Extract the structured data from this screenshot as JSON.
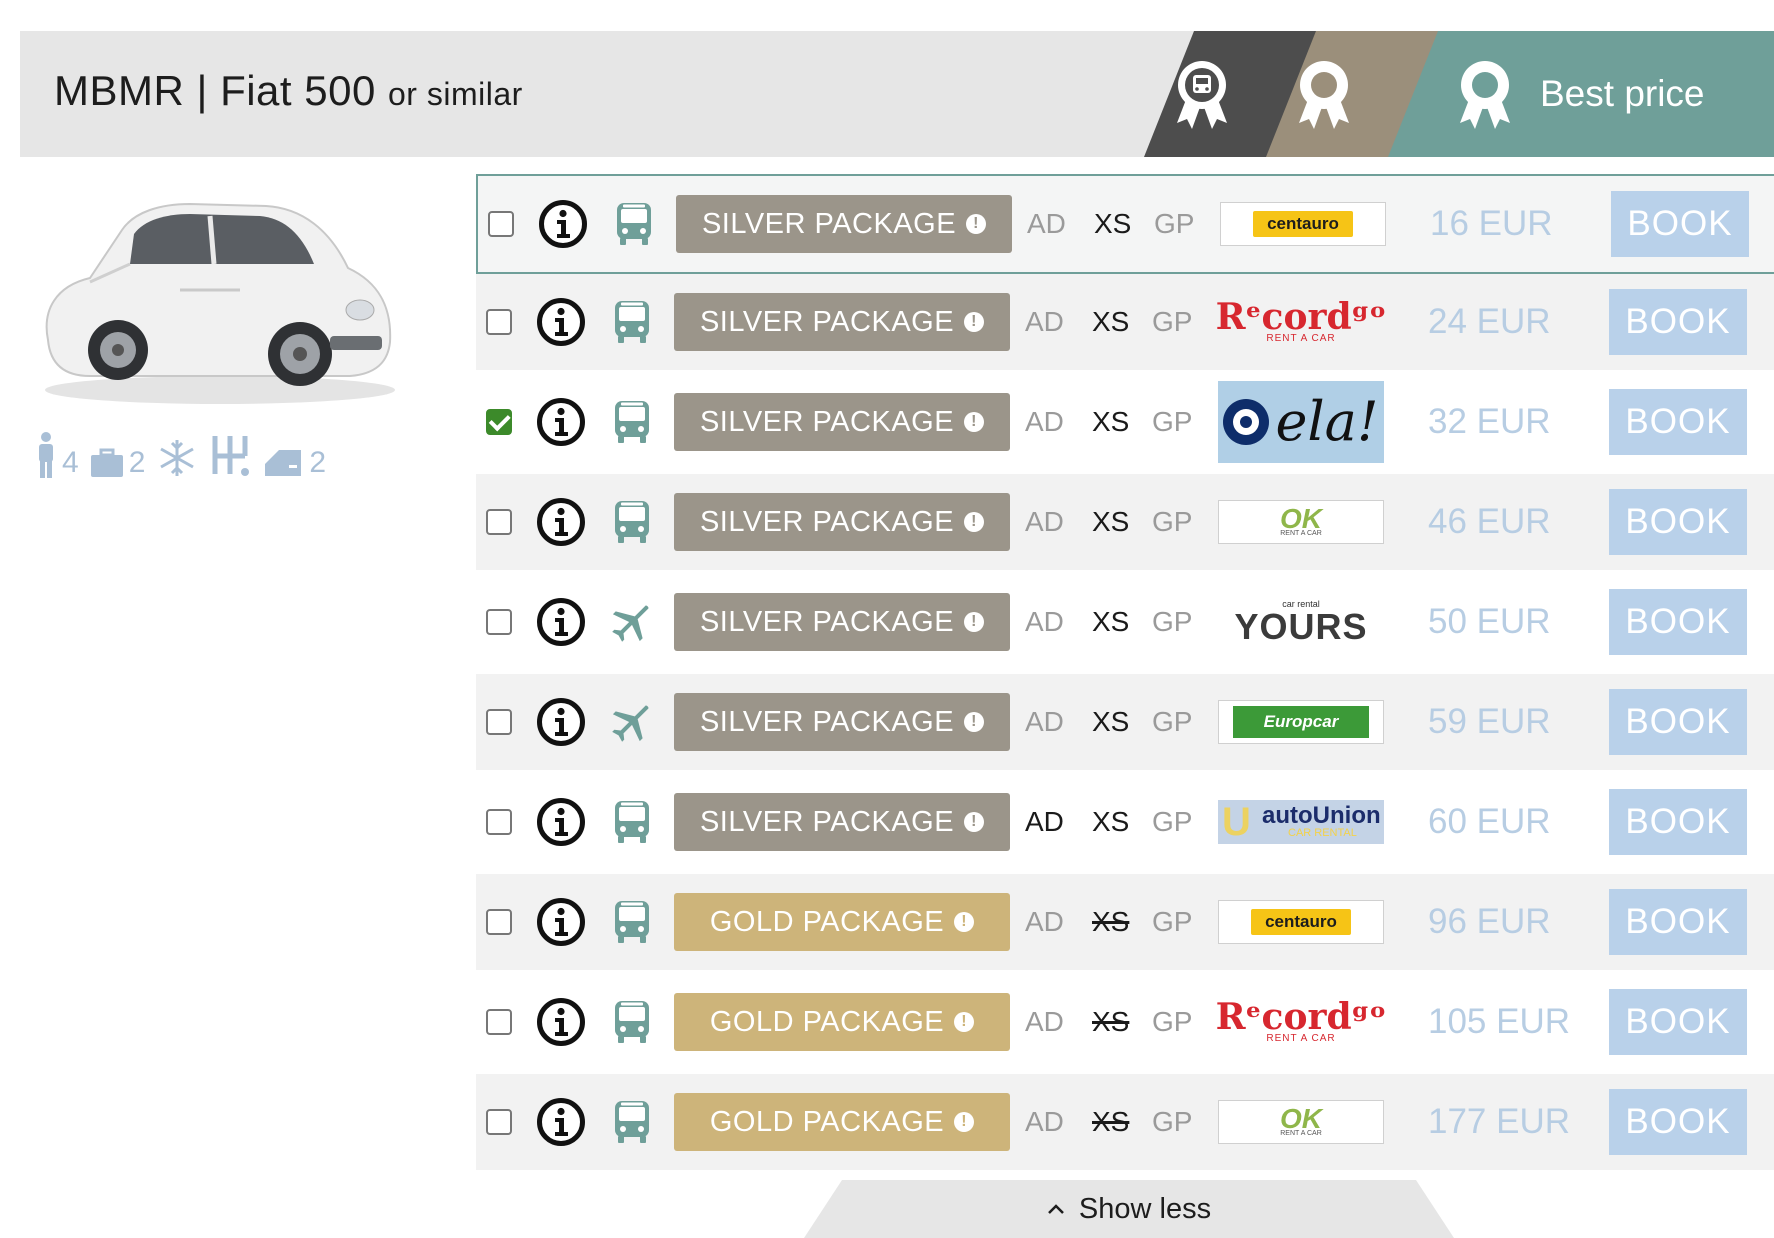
{
  "header": {
    "car_code": "MBMR | Fiat 500",
    "similar": "or similar",
    "best_price_label": "Best price"
  },
  "car": {
    "image_alt": "Fiat 500",
    "specs": {
      "passengers": "4",
      "luggage": "2",
      "doors": "2"
    }
  },
  "offers": [
    {
      "checked": false,
      "transport": "bus",
      "package": "SILVER PACKAGE",
      "tier": "silver",
      "ad": "AD",
      "xs": "XS",
      "gp": "GP",
      "ad_dark": false,
      "xs_struck": false,
      "supplier": "centauro",
      "price": "16 EUR",
      "book": "BOOK"
    },
    {
      "checked": false,
      "transport": "bus",
      "package": "SILVER PACKAGE",
      "tier": "silver",
      "ad": "AD",
      "xs": "XS",
      "gp": "GP",
      "ad_dark": false,
      "xs_struck": false,
      "supplier": "Record go",
      "price": "24 EUR",
      "book": "BOOK"
    },
    {
      "checked": true,
      "transport": "bus",
      "package": "SILVER PACKAGE",
      "tier": "silver",
      "ad": "AD",
      "xs": "XS",
      "gp": "GP",
      "ad_dark": false,
      "xs_struck": false,
      "supplier": "ela!",
      "price": "32 EUR",
      "book": "BOOK"
    },
    {
      "checked": false,
      "transport": "bus",
      "package": "SILVER PACKAGE",
      "tier": "silver",
      "ad": "AD",
      "xs": "XS",
      "gp": "GP",
      "ad_dark": false,
      "xs_struck": false,
      "supplier": "OK",
      "price": "46 EUR",
      "book": "BOOK"
    },
    {
      "checked": false,
      "transport": "plane",
      "package": "SILVER PACKAGE",
      "tier": "silver",
      "ad": "AD",
      "xs": "XS",
      "gp": "GP",
      "ad_dark": false,
      "xs_struck": false,
      "supplier": "YOURS",
      "price": "50 EUR",
      "book": "BOOK"
    },
    {
      "checked": false,
      "transport": "plane",
      "package": "SILVER PACKAGE",
      "tier": "silver",
      "ad": "AD",
      "xs": "XS",
      "gp": "GP",
      "ad_dark": false,
      "xs_struck": false,
      "supplier": "Europcar",
      "price": "59 EUR",
      "book": "BOOK"
    },
    {
      "checked": false,
      "transport": "bus",
      "package": "SILVER PACKAGE",
      "tier": "silver",
      "ad": "AD",
      "xs": "XS",
      "gp": "GP",
      "ad_dark": true,
      "xs_struck": false,
      "supplier": "autoUnion",
      "price": "60 EUR",
      "book": "BOOK"
    },
    {
      "checked": false,
      "transport": "bus",
      "package": "GOLD PACKAGE",
      "tier": "gold",
      "ad": "AD",
      "xs": "XS",
      "gp": "GP",
      "ad_dark": false,
      "xs_struck": true,
      "supplier": "centauro",
      "price": "96 EUR",
      "book": "BOOK"
    },
    {
      "checked": false,
      "transport": "bus",
      "package": "GOLD PACKAGE",
      "tier": "gold",
      "ad": "AD",
      "xs": "XS",
      "gp": "GP",
      "ad_dark": false,
      "xs_struck": true,
      "supplier": "Record go",
      "price": "105 EUR",
      "book": "BOOK"
    },
    {
      "checked": false,
      "transport": "bus",
      "package": "GOLD PACKAGE",
      "tier": "gold",
      "ad": "AD",
      "xs": "XS",
      "gp": "GP",
      "ad_dark": false,
      "xs_struck": true,
      "supplier": "OK",
      "price": "177 EUR",
      "book": "BOOK"
    }
  ],
  "logos": {
    "centauro": "centauro",
    "record_main": "Rᵉcordᵍᵒ",
    "record_sub": "RENT A CAR",
    "ela": "ela!",
    "ok": "OK",
    "ok_sub": "RENT A CAR",
    "yours_sub": "car rental",
    "yours": "YOURS",
    "europcar": "Europcar",
    "autounion": "autoUnion",
    "autounion_sub": "CAR RENTAL"
  },
  "footer": {
    "show_less": "Show less"
  },
  "colors": {
    "header_bg": "#e6e6e6",
    "badge_dark": "#4d4d4d",
    "badge_taupe": "#9b8f7b",
    "badge_teal": "#6f9f99",
    "silver_pkg": "#9b958a",
    "gold_pkg": "#cdb47a",
    "book_btn": "#b9d1ea",
    "price_text": "#b7cde3",
    "transport_icon": "#6f9f99"
  },
  "icons": {
    "badge_1": "bus-award-icon",
    "badge_2": "award-icon",
    "badge_3": "award-icon",
    "info": "info-circle-icon",
    "bus": "bus-icon",
    "plane": "plane-icon",
    "passenger": "person-icon",
    "luggage": "suitcase-icon",
    "ac": "snowflake-icon",
    "gearbox": "manual-gearbox-icon",
    "door": "car-door-icon",
    "show_less": "chevron-up-icon"
  }
}
